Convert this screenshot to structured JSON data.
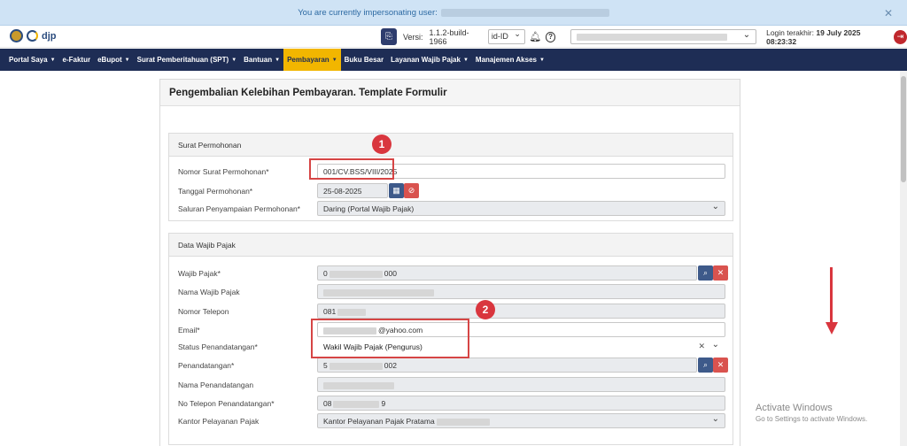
{
  "impersonation": {
    "text": "You are currently impersonating user: ",
    "close": "✕"
  },
  "topbar": {
    "brand": "djp",
    "version_label": "Versi:",
    "version": "1.1.2-build-1966",
    "language": "id-ID",
    "login_label": "Login terakhir:",
    "login_time": "19 July 2025 08:23:32"
  },
  "nav": [
    {
      "label": "Portal Saya",
      "caret": true
    },
    {
      "label": "e-Faktur",
      "caret": false
    },
    {
      "label": "eBupot",
      "caret": true
    },
    {
      "label": "Surat Pemberitahuan (SPT)",
      "caret": true
    },
    {
      "label": "Bantuan",
      "caret": true
    },
    {
      "label": "Pembayaran",
      "caret": true,
      "active": true
    },
    {
      "label": "Buku Besar",
      "caret": false
    },
    {
      "label": "Layanan Wajib Pajak",
      "caret": true
    },
    {
      "label": "Manajemen Akses",
      "caret": true
    }
  ],
  "page": {
    "title": "Pengembalian Kelebihan Pembayaran. Template Formulir"
  },
  "surat": {
    "heading": "Surat Permohonan",
    "nomor_label": "Nomor Surat Permohonan*",
    "nomor_value": "001/CV.BSS/VIII/2025",
    "tanggal_label": "Tanggal Permohonan*",
    "tanggal_value": "25-08-2025",
    "saluran_label": "Saluran Penyampaian Permohonan*",
    "saluran_value": "Daring (Portal Wajib Pajak)"
  },
  "wp": {
    "heading": "Data Wajib Pajak",
    "wajib_label": "Wajib Pajak*",
    "wajib_prefix": "0",
    "wajib_suffix": "000",
    "nama_label": "Nama Wajib Pajak",
    "telepon_label": "Nomor Telepon",
    "telepon_prefix": "081",
    "email_label": "Email*",
    "email_suffix": "@yahoo.com",
    "status_label": "Status Penandatangan*",
    "status_value": "Wakil Wajib Pajak (Pengurus)",
    "penandatangan_label": "Penandatangan*",
    "penandatangan_prefix": "5",
    "penandatangan_suffix": "002",
    "nama_pttd_label": "Nama Penandatangan",
    "telp_pttd_label": "No Telepon Penandatangan*",
    "telp_pttd_prefix": "08",
    "telp_pttd_suffix": "9",
    "kpp_label": "Kantor Pelayanan Pajak",
    "kpp_value": "Kantor Pelayanan Pajak Pratama"
  },
  "annotations": {
    "badge1": "1",
    "badge2": "2"
  },
  "watermark": {
    "line1": "Activate Windows",
    "line2": "Go to Settings to activate Windows."
  },
  "colors": {
    "navbar": "#1e2d55",
    "active_nav": "#f2b600",
    "annotation": "#d9363e"
  }
}
